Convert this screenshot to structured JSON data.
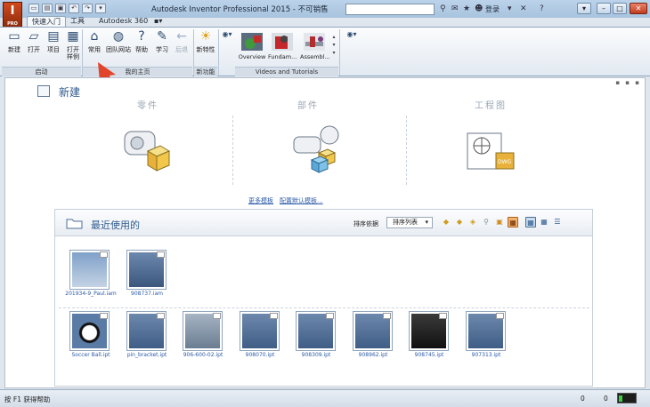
{
  "window": {
    "title": "Autodesk Inventor Professional 2015 - 不可销售",
    "app_logo": "I",
    "app_logo_sub": "PRO"
  },
  "topbar": {
    "sign_in": "登录"
  },
  "tabs": [
    "快速入门",
    "工具",
    "Autodesk 360"
  ],
  "ribbon": {
    "launch": {
      "label": "启动",
      "buttons": [
        "新建",
        "打开",
        "项目",
        "打开样例"
      ]
    },
    "home": {
      "label": "我的主页",
      "buttons": [
        "常用",
        "团队网站",
        "帮助",
        "学习",
        "后退"
      ]
    },
    "newfeatures": {
      "label": "新功能",
      "buttons": [
        "新特性"
      ]
    },
    "videos": {
      "label": "Videos and Tutorials",
      "items": [
        "Overview",
        "Fundam...",
        "Assembl..."
      ]
    }
  },
  "new_section": {
    "title": "新建",
    "columns": [
      "零件",
      "部件",
      "工程图"
    ],
    "links": [
      "更多模板",
      "配置默认模板..."
    ]
  },
  "recent": {
    "title": "最近使用的",
    "sort_label": "排序依据",
    "sort_value": "排序列表",
    "assemblies": [
      "201934-9_Paul.iam",
      "908737.iam"
    ],
    "parts": [
      "Soccer Ball.ipt",
      "pin_bracket.ipt",
      "906-600-02.ipt",
      "908070.ipt",
      "908309.ipt",
      "908962.ipt",
      "908745.ipt",
      "907313.ipt"
    ]
  },
  "status": {
    "help_text": "按 F1 获得帮助",
    "count1": "0",
    "count2": "0"
  },
  "colors": {
    "accent": "#2f5b8c",
    "pointer_arrow": "#e2452b"
  }
}
